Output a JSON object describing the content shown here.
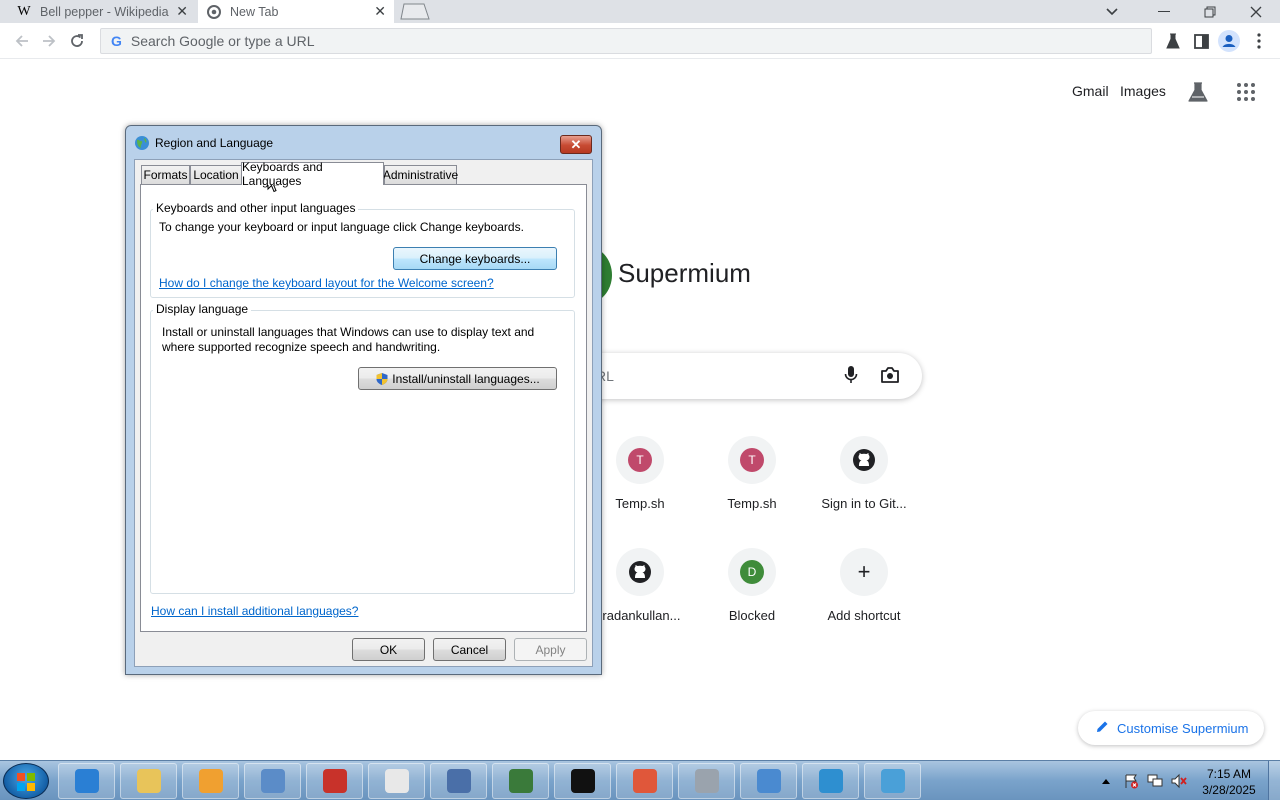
{
  "browser": {
    "tabs": [
      {
        "title": "Bell pepper - Wikipedia",
        "favicon": "W",
        "close": "✕"
      },
      {
        "title": "New Tab",
        "close": "✕"
      }
    ],
    "omnibox_placeholder": "Search Google or type a URL",
    "omnibox_logo": "G"
  },
  "ntp": {
    "header_links": [
      "Gmail",
      "Images"
    ],
    "brand": "Supermium",
    "search_placeholder_fragment": "RL",
    "shortcuts": [
      {
        "title": "Temp.sh",
        "letter": "T",
        "color": "#c0496b"
      },
      {
        "title": "Temp.sh",
        "letter": "T",
        "color": "#c0496b"
      },
      {
        "title": "Sign in to Git...",
        "icon": "github-icon"
      },
      {
        "title": "iradankullan...",
        "icon": "github-icon"
      },
      {
        "title": "Blocked",
        "letter": "D",
        "color": "#3f8c3a"
      },
      {
        "title": "Add shortcut",
        "icon": "plus-icon",
        "glyph": "+"
      }
    ],
    "customise_label": "Customise Supermium"
  },
  "dialog": {
    "title": "Region and Language",
    "close_glyph": "✕",
    "tabs": [
      "Formats",
      "Location",
      "Keyboards and Languages",
      "Administrative"
    ],
    "selected_tab": "Keyboards and Languages",
    "kb_group": {
      "legend": "Keyboards and other input languages",
      "description": "To change your keyboard or input language click Change keyboards.",
      "button": "Change keyboards...",
      "link": "How do I change the keyboard layout for the Welcome screen?"
    },
    "display_group": {
      "legend": "Display language",
      "description_line1": "Install or uninstall languages that Windows can use to display text and",
      "description_line2": "where supported recognize speech and handwriting.",
      "button": "Install/uninstall languages..."
    },
    "bottom_link": "How can I install additional languages?",
    "buttons": {
      "ok": "OK",
      "cancel": "Cancel",
      "apply": "Apply"
    }
  },
  "taskbar": {
    "pinned": [
      {
        "name": "ie-icon",
        "color": "#2a7fd4"
      },
      {
        "name": "explorer-icon",
        "color": "#e8c45a"
      },
      {
        "name": "media-player-icon",
        "color": "#f0a030"
      },
      {
        "name": "computer-icon",
        "color": "#5b8cc8"
      },
      {
        "name": "toolbox-icon",
        "color": "#c8322a"
      },
      {
        "name": "notepad-icon",
        "color": "#e8e8e8"
      },
      {
        "name": "user-icon",
        "color": "#4a6fa8"
      },
      {
        "name": "monitor-icon",
        "color": "#3a7a3a"
      },
      {
        "name": "cmd-icon",
        "color": "#111111"
      },
      {
        "name": "paint-icon",
        "color": "#e0573a"
      },
      {
        "name": "sheet-icon",
        "color": "#9aa3ad"
      },
      {
        "name": "network-icon",
        "color": "#4a8ad0"
      },
      {
        "name": "globe-icon",
        "color": "#2e8fd0"
      },
      {
        "name": "region-icon",
        "color": "#4aa0d8"
      }
    ],
    "clock_time": "7:15 AM",
    "clock_date": "3/28/2025"
  }
}
